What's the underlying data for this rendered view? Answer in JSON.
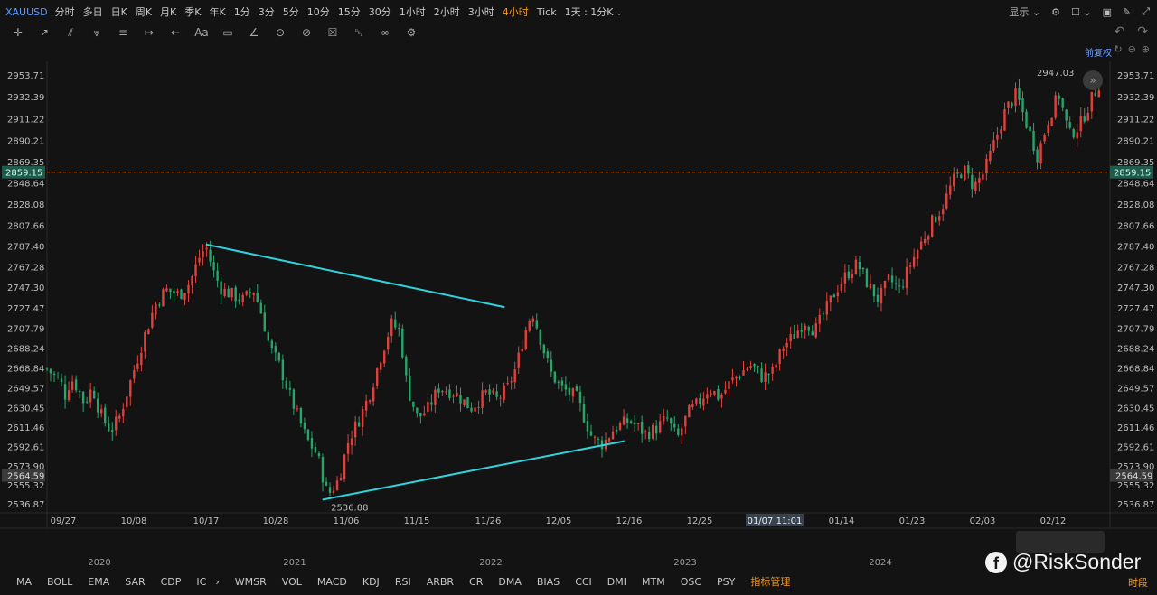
{
  "symbol": "XAUUSD",
  "timeframes": [
    {
      "label": "分时"
    },
    {
      "label": "多日"
    },
    {
      "label": "日K"
    },
    {
      "label": "周K"
    },
    {
      "label": "月K"
    },
    {
      "label": "季K"
    },
    {
      "label": "年K"
    },
    {
      "label": "1分"
    },
    {
      "label": "3分"
    },
    {
      "label": "5分"
    },
    {
      "label": "10分"
    },
    {
      "label": "15分"
    },
    {
      "label": "30分"
    },
    {
      "label": "1小时"
    },
    {
      "label": "2小时"
    },
    {
      "label": "3小时"
    },
    {
      "label": "4小时",
      "active": true
    },
    {
      "label": "Tick"
    },
    {
      "label": "1天 : 1分K",
      "dropdown": true
    }
  ],
  "top_right": {
    "display_label": "显示"
  },
  "adjust_label": "前复权",
  "tools": [
    "crosshair-icon",
    "trendline-icon",
    "channel-icon",
    "pattern-icon",
    "fib-icon",
    "measure-icon",
    "arrow-icon",
    "text-icon",
    "note-icon",
    "brush-icon",
    "magnet-icon",
    "hide-icon",
    "lock-icon",
    "trash-icon",
    "link-icon",
    "settings-icon"
  ],
  "tool_text": "Aa",
  "chart_data": {
    "type": "candlestick",
    "y_ticks": [
      "2953.71",
      "2932.39",
      "2911.22",
      "2890.21",
      "2869.35",
      "2848.64",
      "2828.08",
      "2807.66",
      "2787.40",
      "2767.28",
      "2747.30",
      "2727.47",
      "2707.79",
      "2688.24",
      "2668.84",
      "2649.57",
      "2630.45",
      "2611.46",
      "2592.61",
      "2573.90",
      "2555.32",
      "2536.87"
    ],
    "ylim": [
      2530,
      2965
    ],
    "current_price_label": "2859.15",
    "current_price": 2859.15,
    "left_low_label": "2564.59",
    "left_low_value": 2564.59,
    "high_annotation": "2947.03",
    "low_annotation": "2536.88",
    "x_ticks": [
      "09/27",
      "10/08",
      "10/17",
      "10/28",
      "11/06",
      "11/15",
      "11/26",
      "12/05",
      "12/16",
      "12/25",
      "01/07 11:01",
      "01/14",
      "01/23",
      "02/03",
      "02/12"
    ],
    "crosshair_date": "01/07 11:01",
    "overview_years": [
      "2020",
      "2021",
      "2022",
      "2023",
      "2024"
    ],
    "close_path": [
      [
        0,
        2668
      ],
      [
        1.3,
        2655
      ],
      [
        1.8,
        2640
      ],
      [
        2.2,
        2660
      ],
      [
        3.0,
        2648
      ],
      [
        3.5,
        2635
      ],
      [
        4.3,
        2650
      ],
      [
        5.0,
        2625
      ],
      [
        6.0,
        2608
      ],
      [
        6.8,
        2620
      ],
      [
        8.0,
        2660
      ],
      [
        9.2,
        2700
      ],
      [
        10.2,
        2730
      ],
      [
        11.2,
        2745
      ],
      [
        12.5,
        2740
      ],
      [
        13.5,
        2752
      ],
      [
        14.3,
        2775
      ],
      [
        15.0,
        2787
      ],
      [
        15.8,
        2760
      ],
      [
        16.5,
        2745
      ],
      [
        17.5,
        2740
      ],
      [
        18.5,
        2735
      ],
      [
        19.5,
        2745
      ],
      [
        20.3,
        2720
      ],
      [
        21.0,
        2690
      ],
      [
        22.0,
        2670
      ],
      [
        23.0,
        2640
      ],
      [
        24.5,
        2600
      ],
      [
        25.5,
        2585
      ],
      [
        26.5,
        2545
      ],
      [
        27.5,
        2560
      ],
      [
        28.5,
        2600
      ],
      [
        29.5,
        2620
      ],
      [
        30.5,
        2645
      ],
      [
        31.5,
        2680
      ],
      [
        32.5,
        2712
      ],
      [
        33.3,
        2705
      ],
      [
        34.0,
        2650
      ],
      [
        35.0,
        2620
      ],
      [
        36.0,
        2630
      ],
      [
        37.0,
        2650
      ],
      [
        38.5,
        2645
      ],
      [
        40.0,
        2630
      ],
      [
        41.5,
        2645
      ],
      [
        42.5,
        2638
      ],
      [
        43.5,
        2650
      ],
      [
        44.3,
        2670
      ],
      [
        45.0,
        2700
      ],
      [
        45.8,
        2725
      ],
      [
        46.5,
        2700
      ],
      [
        47.5,
        2665
      ],
      [
        48.5,
        2650
      ],
      [
        50.0,
        2640
      ],
      [
        51.5,
        2600
      ],
      [
        52.5,
        2595
      ],
      [
        53.5,
        2610
      ],
      [
        55.0,
        2618
      ],
      [
        56.5,
        2605
      ],
      [
        57.5,
        2610
      ],
      [
        58.5,
        2620
      ],
      [
        59.5,
        2600
      ],
      [
        60.5,
        2625
      ],
      [
        61.5,
        2635
      ],
      [
        62.5,
        2650
      ],
      [
        63.5,
        2640
      ],
      [
        64.5,
        2655
      ],
      [
        65.5,
        2665
      ],
      [
        66.5,
        2672
      ],
      [
        67.5,
        2660
      ],
      [
        68.5,
        2665
      ],
      [
        69.5,
        2690
      ],
      [
        70.5,
        2700
      ],
      [
        71.5,
        2715
      ],
      [
        72.5,
        2705
      ],
      [
        73.5,
        2725
      ],
      [
        74.5,
        2745
      ],
      [
        75.5,
        2760
      ],
      [
        76.5,
        2770
      ],
      [
        77.5,
        2750
      ],
      [
        78.5,
        2735
      ],
      [
        79.5,
        2755
      ],
      [
        80.5,
        2745
      ],
      [
        81.5,
        2770
      ],
      [
        82.5,
        2790
      ],
      [
        83.5,
        2810
      ],
      [
        84.5,
        2825
      ],
      [
        85.5,
        2850
      ],
      [
        86.5,
        2862
      ],
      [
        87.5,
        2845
      ],
      [
        88.5,
        2860
      ],
      [
        89.5,
        2890
      ],
      [
        90.5,
        2920
      ],
      [
        91.5,
        2935
      ],
      [
        92.5,
        2905
      ],
      [
        93.5,
        2875
      ],
      [
        94.5,
        2910
      ],
      [
        95.5,
        2935
      ],
      [
        96.5,
        2895
      ],
      [
        97.5,
        2905
      ],
      [
        98.5,
        2928
      ],
      [
        99.3,
        2945
      ]
    ],
    "trendlines": [
      {
        "from": [
          15.0,
          2789
        ],
        "to": [
          43.2,
          2728
        ]
      },
      {
        "from": [
          26.0,
          2541
        ],
        "to": [
          54.5,
          2598
        ]
      }
    ]
  },
  "indicators": [
    "MA",
    "BOLL",
    "EMA",
    "SAR",
    "CDP",
    "IC",
    "WMSR",
    "VOL",
    "MACD",
    "KDJ",
    "RSI",
    "ARBR",
    "CR",
    "DMA",
    "BIAS",
    "CCI",
    "DMI",
    "MTM",
    "OSC",
    "PSY"
  ],
  "indicator_manage": "指标管理",
  "time_segment": "时段",
  "watermark": "@RiskSonder"
}
